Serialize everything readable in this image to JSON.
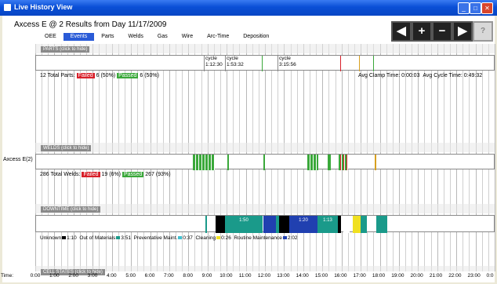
{
  "window": {
    "title": "Live History View"
  },
  "heading": "Axcess E @ 2 Results from Day 11/17/2009",
  "tabs": [
    {
      "label": "OEE",
      "active": false
    },
    {
      "label": "Events",
      "active": true
    },
    {
      "label": "Parts",
      "active": false
    },
    {
      "label": "Welds",
      "active": false
    },
    {
      "label": "Gas",
      "active": false
    },
    {
      "label": "Wire",
      "active": false
    },
    {
      "label": "Arc-Time",
      "active": false
    },
    {
      "label": "Deposition",
      "active": false
    }
  ],
  "nav_buttons": [
    {
      "label": "◀",
      "icon": "left-arrow-icon"
    },
    {
      "label": "+",
      "icon": "plus-icon"
    },
    {
      "label": "−",
      "icon": "minus-icon"
    },
    {
      "label": "▶",
      "icon": "right-arrow-icon"
    },
    {
      "label": "?",
      "icon": "help-icon"
    }
  ],
  "machine_label": "Axcess E(2)",
  "sections": {
    "parts": {
      "label": "PARTS (click to hide)",
      "total": "12 Total Parts:",
      "failed_label": "Failed",
      "failed_value": "6 (50%)",
      "passed_label": "Passed",
      "passed_value": "6 (50%)",
      "avg_clamp": "Avg Clamp Time: 0:00:03",
      "avg_cycle": "Avg Cycle Time: 0:49:32",
      "cycles": [
        {
          "label": "cycle",
          "time": "1:12:30"
        },
        {
          "label": "cycle",
          "time": "1:53:32"
        },
        {
          "label": "cycle",
          "time": "3:15:56"
        }
      ]
    },
    "welds": {
      "label": "WELDS (click to hide)",
      "total": "286 Total Welds:",
      "failed_label": "Failed",
      "failed_value": "19 (6%)",
      "passed_label": "Passed",
      "passed_value": "267 (93%)"
    },
    "downtime": {
      "label": "DOWNTIME (click to hide)",
      "segment_labels": [
        "1:50",
        "1:20",
        "1:13"
      ],
      "summary": [
        {
          "name": "Unknown",
          "value": "1:10",
          "color": "#000000"
        },
        {
          "name": "Out of Materials",
          "value": "3:51",
          "color": "#1a9a8a"
        },
        {
          "name": "Preventative Maint.",
          "value": "0:37",
          "color": "#40c0d0"
        },
        {
          "name": "Cleaning",
          "value": "0:26",
          "color": "#f0e020"
        },
        {
          "name": "Routine Maintenance",
          "value": "2:02",
          "color": "#2040b0"
        }
      ]
    },
    "cell_states": {
      "label": "CELL STATES (click to hide)"
    }
  },
  "axis": {
    "label": "Time:",
    "ticks": [
      "0:00",
      "1:00",
      "2:00",
      "3:00",
      "4:00",
      "5:00",
      "6:00",
      "7:00",
      "8:00",
      "9:00",
      "10:00",
      "11:00",
      "12:00",
      "13:00",
      "14:00",
      "15:00",
      "16:00",
      "17:00",
      "18:00",
      "19:00",
      "20:00",
      "21:00",
      "22:00",
      "23:00",
      "0:0"
    ]
  },
  "colors": {
    "failed": "#d8202a",
    "passed": "#3aa83a",
    "tab_active": "#2a5bd7"
  }
}
